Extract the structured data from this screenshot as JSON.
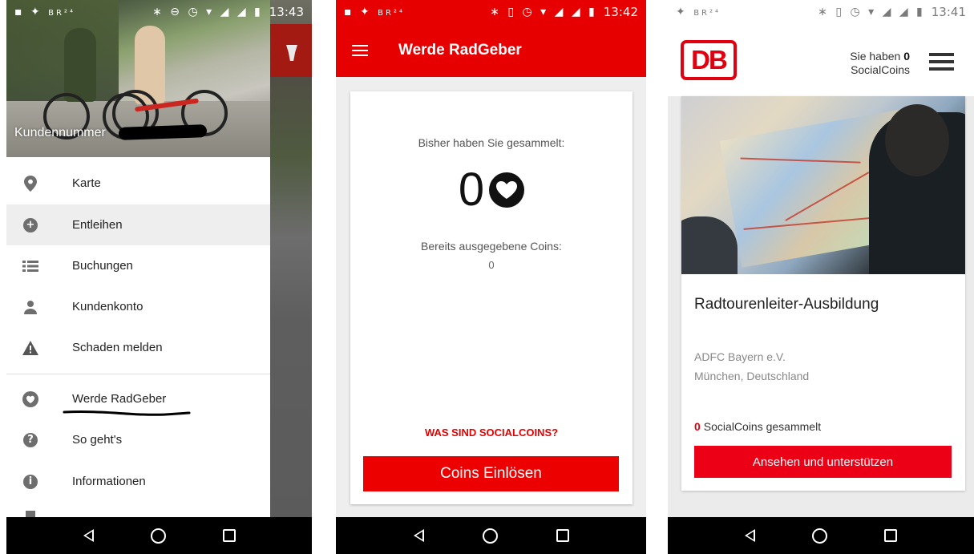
{
  "screens": {
    "drawer": {
      "status_time": "13:43",
      "customer_label": "Kundennummer",
      "menu": [
        {
          "label": "Karte",
          "icon": "map-pin-icon"
        },
        {
          "label": "Entleihen",
          "icon": "plus-circle-icon"
        },
        {
          "label": "Buchungen",
          "icon": "list-icon"
        },
        {
          "label": "Kundenkonto",
          "icon": "person-icon"
        },
        {
          "label": "Schaden melden",
          "icon": "warning-icon"
        },
        {
          "label": "Werde RadGeber",
          "icon": "heart-circle-icon"
        },
        {
          "label": "So geht's",
          "icon": "help-circle-icon"
        },
        {
          "label": "Informationen",
          "icon": "info-circle-icon"
        }
      ],
      "active_item": "Entleihen"
    },
    "radgeber": {
      "status_time": "13:42",
      "title": "Werde RadGeber",
      "collected_label": "Bisher haben Sie gesammelt:",
      "collected_value": "0",
      "spent_label": "Bereits ausgegebene Coins:",
      "spent_value": "0",
      "info_link": "WAS SIND SOCIALCOINS?",
      "redeem_button": "Coins Einlösen",
      "accent": "#e60000"
    },
    "db": {
      "status_time": "13:41",
      "logo": "DB",
      "coins_prefix": "Sie haben",
      "coins_value": "0",
      "coins_suffix": "SocialCoins",
      "card_title": "Radtourenleiter-Ausbildung",
      "organizer": "ADFC Bayern e.V.",
      "location": "München, Deutschland",
      "collected_value": "0",
      "collected_text": "SocialCoins gesammelt",
      "support_button": "Ansehen und unterstützen",
      "accent": "#ec0016"
    }
  }
}
